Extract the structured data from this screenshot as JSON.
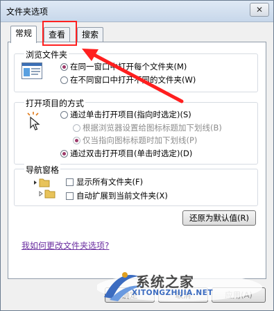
{
  "window": {
    "title": "文件夹选项",
    "close_glyph": "✕"
  },
  "tabs": [
    {
      "label": "常规",
      "active": true
    },
    {
      "label": "查看",
      "active": false
    },
    {
      "label": "搜索",
      "active": false
    }
  ],
  "browse_folders": {
    "title": "浏览文件夹",
    "options": [
      {
        "label": "在同一窗口中打开每个文件夹(M)",
        "selected": true
      },
      {
        "label": "在不同窗口中打开不同的文件夹(W)",
        "selected": false
      }
    ]
  },
  "click_items": {
    "title": "打开项目的方式",
    "options": [
      {
        "label": "通过单击打开项目(指向时选定)(S)",
        "selected": false
      },
      {
        "label": "根据浏览器设置给图标标题加下划线(B)",
        "selected": false,
        "disabled": true
      },
      {
        "label": "仅当指向图标标题时加下划线(P)",
        "selected": true,
        "disabled": true
      },
      {
        "label": "通过双击打开项目(单击时选定)(D)",
        "selected": true
      }
    ]
  },
  "navigation_pane": {
    "title": "导航窗格",
    "options": [
      {
        "label": "显示所有文件夹(F)",
        "checked": false
      },
      {
        "label": "自动扩展到当前文件夹(X)",
        "checked": false
      }
    ]
  },
  "buttons": {
    "restore_defaults": "还原为默认值(R)",
    "ok": "确定",
    "cancel": "取消",
    "apply": "应用(A)"
  },
  "help_link": "我如何更改文件夹选项?",
  "watermark": {
    "name": "系统之家",
    "url": "XITONGZHIJIA.NET"
  },
  "colors": {
    "highlight": "#ff1f1f",
    "link": "#6b2fa0",
    "watermark_blue": "#3c6cc0"
  }
}
